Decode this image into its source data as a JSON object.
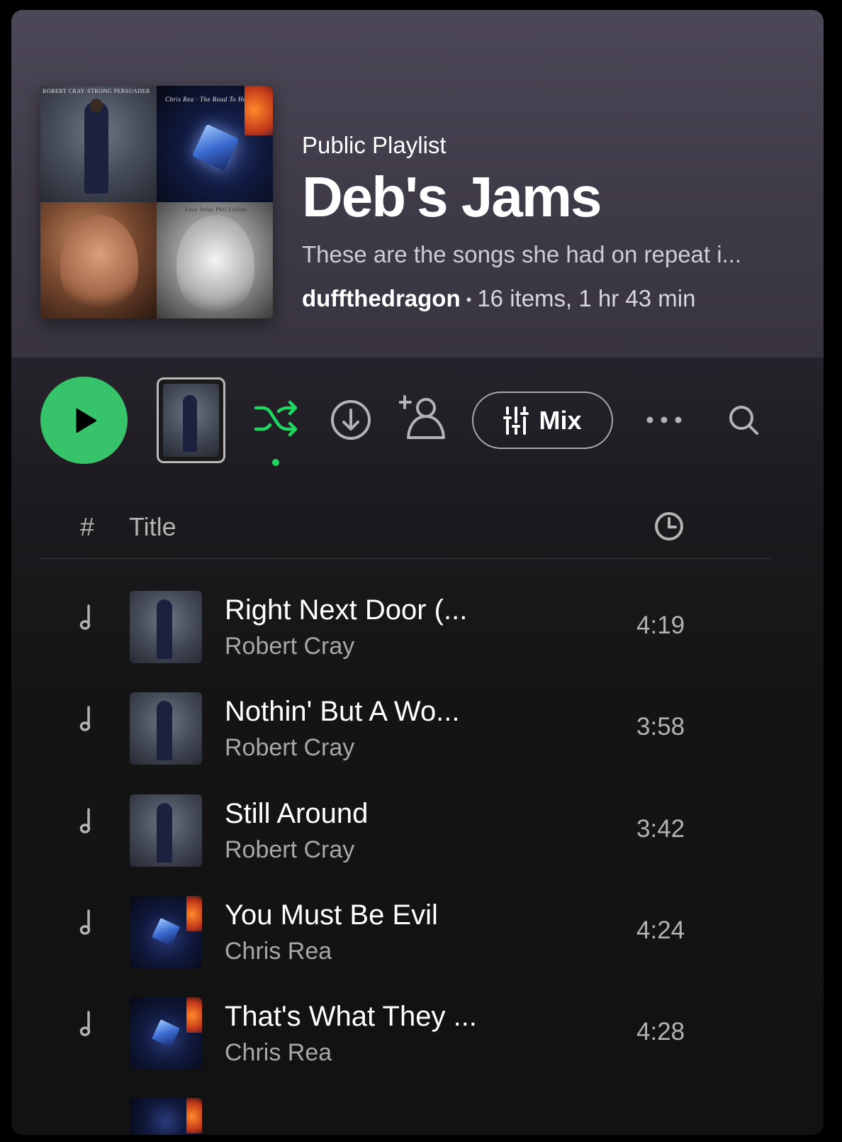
{
  "header": {
    "playlist_type": "Public Playlist",
    "title": "Deb's Jams",
    "description": "These are the songs she had on repeat i...",
    "owner": "duffthedragon",
    "separator": "•",
    "stats": "16 items, 1 hr 43 min",
    "cover": {
      "top_left_text": "ROBERT CRAY·STRONG PERSUADER",
      "top_right_text": "Chris Rea · The Road To Hell",
      "bottom_right_text": "Face Value  Phil Collins"
    }
  },
  "controls": {
    "play_icon": "play-icon",
    "shuffle_icon": "shuffle-icon",
    "shuffle_active": true,
    "download_icon": "download-icon",
    "add_user_icon": "add-user-icon",
    "mix_label": "Mix",
    "mix_icon": "sliders-icon",
    "more_icon": "more-icon",
    "search_icon": "search-icon"
  },
  "list_header": {
    "number": "#",
    "title": "Title",
    "duration_icon": "clock-icon"
  },
  "tracks": [
    {
      "title": "Right Next Door (...",
      "artist": "Robert Cray",
      "duration": "4:19",
      "album_art": "robert"
    },
    {
      "title": "Nothin' But A Wo...",
      "artist": "Robert Cray",
      "duration": "3:58",
      "album_art": "robert"
    },
    {
      "title": "Still Around",
      "artist": "Robert Cray",
      "duration": "3:42",
      "album_art": "robert"
    },
    {
      "title": "You Must Be Evil",
      "artist": "Chris Rea",
      "duration": "4:24",
      "album_art": "chris"
    },
    {
      "title": "That's What They ...",
      "artist": "Chris Rea",
      "duration": "4:28",
      "album_art": "chris"
    }
  ],
  "colors": {
    "accent": "#1ed760",
    "background": "#121212",
    "header_gradient_top": "#4d4857",
    "text_secondary": "#a7a7a7"
  }
}
